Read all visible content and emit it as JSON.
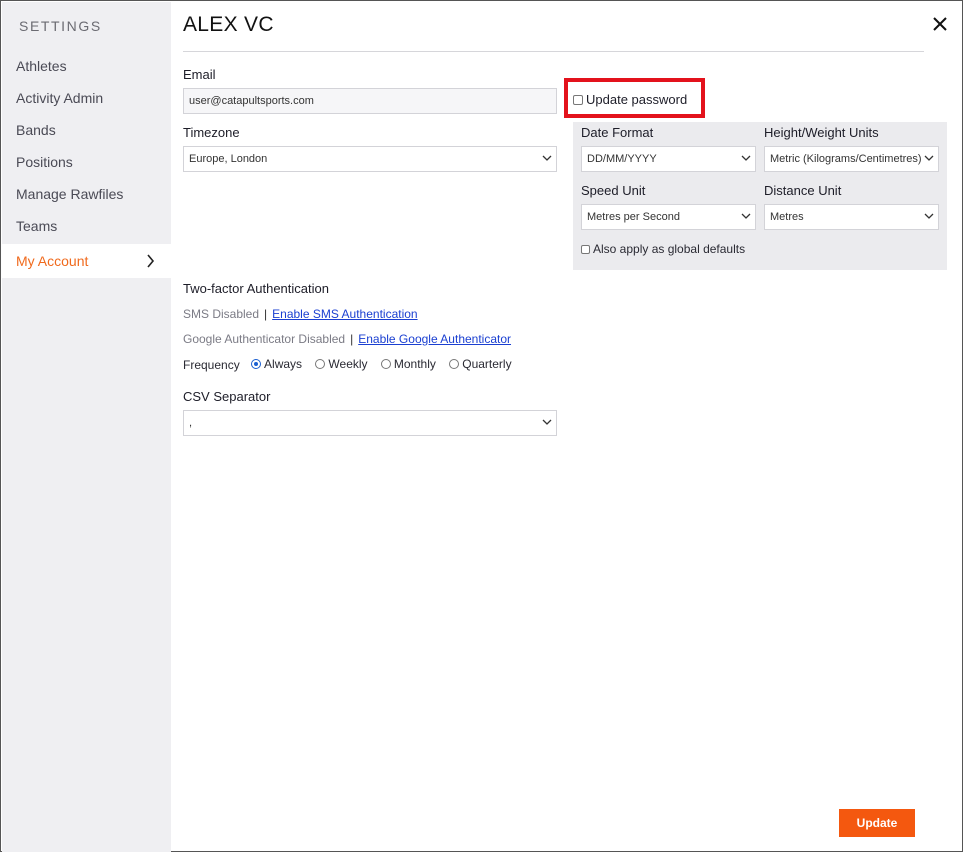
{
  "sidebar": {
    "title": "SETTINGS",
    "items": [
      {
        "label": "Athletes"
      },
      {
        "label": "Activity Admin"
      },
      {
        "label": "Bands"
      },
      {
        "label": "Positions"
      },
      {
        "label": "Manage Rawfiles"
      },
      {
        "label": "Teams"
      },
      {
        "label": "My Account",
        "active": true
      }
    ]
  },
  "header": {
    "title": "ALEX VC"
  },
  "form": {
    "email_label": "Email",
    "email_value": "user@catapultsports.com",
    "update_password_label": "Update password",
    "timezone_label": "Timezone",
    "timezone_value": "Europe, London",
    "date_format_label": "Date Format",
    "date_format_value": "DD/MM/YYYY",
    "height_weight_label": "Height/Weight Units",
    "height_weight_value": "Metric (Kilograms/Centimetres)",
    "speed_unit_label": "Speed Unit",
    "speed_unit_value": "Metres per Second",
    "distance_unit_label": "Distance Unit",
    "distance_unit_value": "Metres",
    "global_defaults_label": "Also apply as global defaults",
    "two_factor_title": "Two-factor Authentication",
    "sms_status": "SMS Disabled",
    "sms_link": "Enable SMS Authentication",
    "google_status": "Google Authenticator Disabled",
    "google_link": "Enable Google Authenticator",
    "separator_char": "|",
    "frequency_label": "Frequency",
    "frequency_options": [
      "Always",
      "Weekly",
      "Monthly",
      "Quarterly"
    ],
    "frequency_selected": "Always",
    "csv_label": "CSV Separator",
    "csv_value": ","
  },
  "footer": {
    "update_label": "Update"
  },
  "colors": {
    "accent": "#f06a1d",
    "button": "#f4580f",
    "highlight": "#e3121c",
    "link": "#1a3fd1"
  }
}
